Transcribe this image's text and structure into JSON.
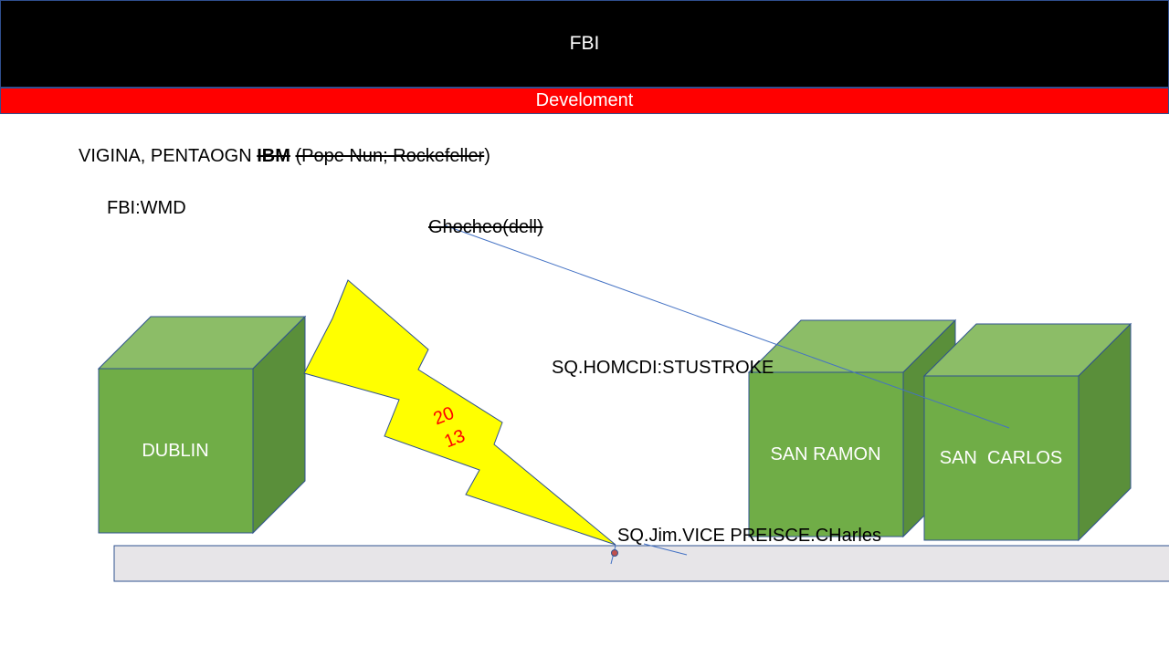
{
  "header": {
    "title": "FBI",
    "subtitle": "Develoment"
  },
  "texts": {
    "line1_prefix": "VIGINA, PENTAOGN ",
    "line1_bold_struck": "IBM",
    "line1_struck": "(Pope Nun; Rockefeller",
    "line1_suffix": ")",
    "fbi_wmd": "FBI:WMD",
    "ghocheo": "Ghocheo(dell)",
    "sq_homcdi": "SQ.HOMCDI:STUSTROKE",
    "sq_jim": "SQ.Jim.VICE PREISCE.CHarles"
  },
  "boxes": {
    "dublin": "DUBLIN",
    "san_ramon": "SAN RAMON",
    "san_carlos": "SAN  CARLOS"
  },
  "bolt": {
    "line1": "20",
    "line2": "13"
  },
  "colors": {
    "cube_front": "#70ad47",
    "cube_top": "#8cbd67",
    "cube_side": "#5a8f3a",
    "bolt": "#ffff00",
    "strip": "#e7e5e8",
    "connector": "#4472c4"
  }
}
